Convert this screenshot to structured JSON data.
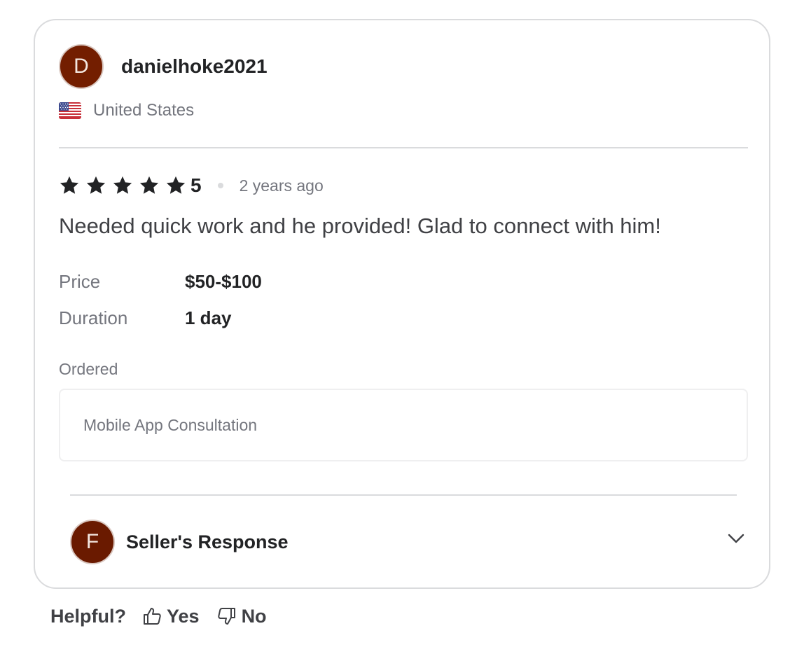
{
  "reviewer": {
    "avatar_letter": "D",
    "avatar_color": "#731e00",
    "username": "danielhoke2021",
    "country": "United States",
    "flag_icon": "us-flag-icon"
  },
  "review": {
    "rating": 5,
    "rating_label": "5",
    "star_icon": "star-icon",
    "time_ago": "2 years ago",
    "text": "Needed quick work and he provided! Glad to connect with him!",
    "price_label": "Price",
    "price_value": "$50-$100",
    "duration_label": "Duration",
    "duration_value": "1 day",
    "ordered_label": "Ordered",
    "ordered_item": "Mobile App Consultation"
  },
  "seller_response": {
    "avatar_letter": "F",
    "title": "Seller's Response",
    "expand_icon": "chevron-down-icon"
  },
  "helpful": {
    "label": "Helpful?",
    "yes_label": "Yes",
    "no_label": "No",
    "yes_icon": "thumbs-up-icon",
    "no_icon": "thumbs-down-icon"
  },
  "colors": {
    "star": "#222325",
    "muted_text": "#74767e",
    "border": "#dadbdd",
    "avatar_bg": "#731e00"
  }
}
